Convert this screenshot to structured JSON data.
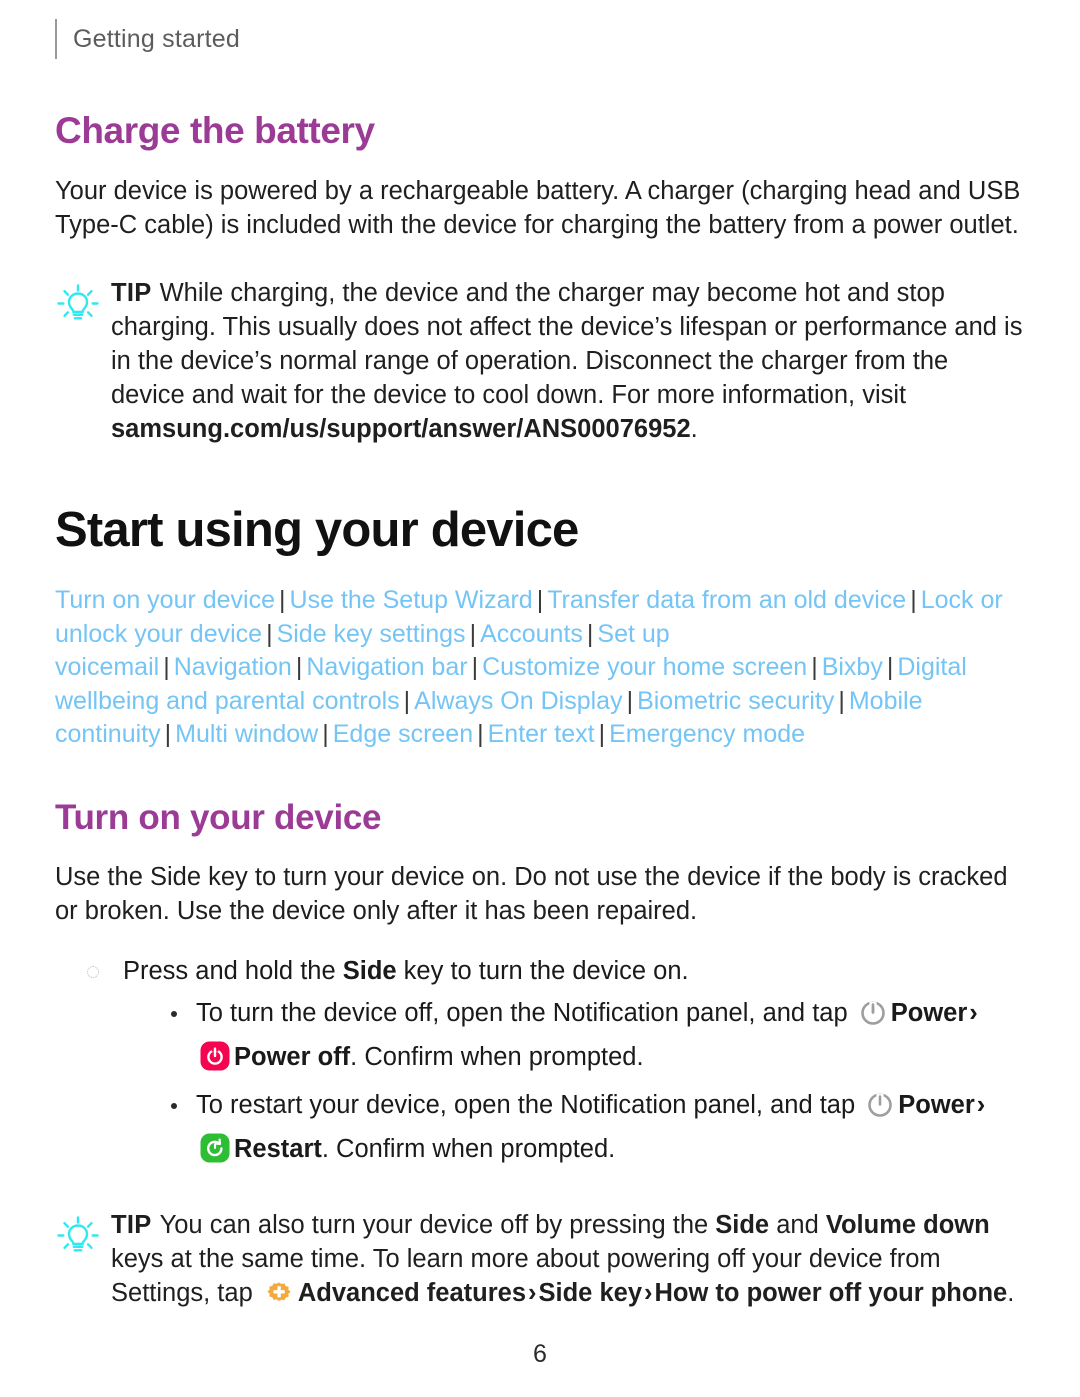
{
  "header": {
    "running_title": "Getting started"
  },
  "sections": {
    "charge_battery": {
      "title": "Charge the battery",
      "body": "Your device is powered by a rechargeable battery. A charger (charging head and USB Type-C cable) is included with the device for charging the battery from a power outlet.",
      "tip": {
        "label": "TIP",
        "icon": "lightbulb-icon",
        "text_before_url": "While charging, the device and the charger may become hot and stop charging. This usually does not affect the device’s lifespan or performance and is in the device’s normal range of operation. Disconnect the charger from the device and wait for the device to cool down. For more information, visit ",
        "url": "samsung.com/us/support/answer/ANS00076952",
        "text_after_url": "."
      }
    },
    "start_using": {
      "title": "Start using your device",
      "links": [
        "Turn on your device",
        "Use the Setup Wizard",
        "Transfer data from an old device",
        "Lock or unlock your device",
        "Side key settings",
        "Accounts",
        "Set up voicemail",
        "Navigation",
        "Navigation bar",
        "Customize your home screen",
        "Bixby",
        "Digital wellbeing and parental controls",
        "Always On Display",
        "Biometric security",
        "Mobile continuity",
        "Multi window",
        "Edge screen",
        "Enter text",
        "Emergency mode"
      ],
      "link_separator": "|"
    },
    "turn_on_device": {
      "title": "Turn on your device",
      "body_part1": "Use the Side key to turn your device on. Do not use the device if the body is cracked or broken. Use the device only after it has been repaired.",
      "steps": {
        "main": {
          "text_before_bold": "Press and hold the ",
          "bold": "Side",
          "text_after_bold": " key to turn the device on."
        },
        "sub": [
          {
            "text_before_icon": "To turn the device off, open the Notification panel, and tap ",
            "power_icon": "power-outline-icon",
            "power_label": "Power",
            "chevron": "›",
            "action_icon": "power-off-icon",
            "action_icon_color": "#F5054F",
            "action_label": "Power off",
            "text_after": ". Confirm when prompted."
          },
          {
            "text_before_icon": "To restart your device, open the Notification panel, and tap ",
            "power_icon": "power-outline-icon",
            "power_label": "Power",
            "chevron": "›",
            "action_icon": "restart-icon",
            "action_icon_color": "#2DBE35",
            "action_label": "Restart",
            "text_after": ". Confirm when prompted."
          }
        ]
      },
      "tip": {
        "label": "TIP",
        "icon": "lightbulb-icon",
        "part1": "You can also turn your device off by pressing the ",
        "bold1": "Side",
        "part2": " and ",
        "bold2": "Volume down",
        "part3": " keys at the same time. To learn more about powering off your device from Settings, tap ",
        "settings_icon": "advanced-features-gear-icon",
        "settings_icon_color": "#F5A93C",
        "bold3": "Advanced features",
        "chevron1": "›",
        "bold4": "Side key",
        "chevron2": "›",
        "bold5": "How to power off your phone",
        "part4": "."
      }
    }
  },
  "footer": {
    "page_number": "6"
  },
  "colors": {
    "heading_purple": "#9B3B96",
    "link_blue": "#74C4F5",
    "tip_cyan": "#2FE8F0",
    "power_off_pink": "#F5054F",
    "restart_green": "#2DBE35",
    "settings_orange": "#F5A93C"
  }
}
